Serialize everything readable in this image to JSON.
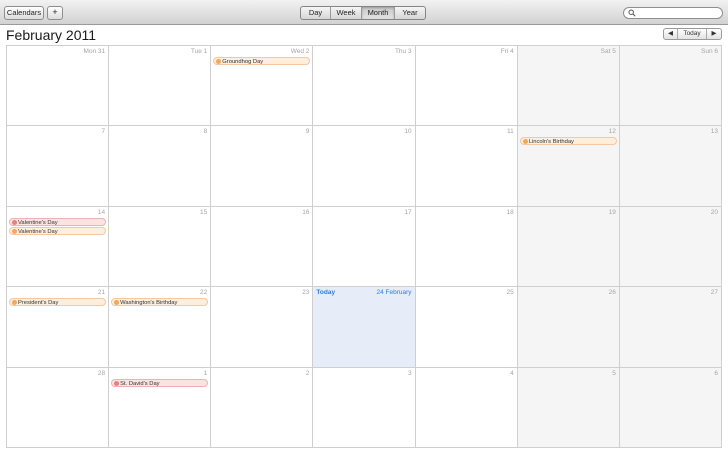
{
  "toolbar": {
    "calendars_label": "Calendars",
    "add_label": "+",
    "views": [
      {
        "label": "Day",
        "active": false
      },
      {
        "label": "Week",
        "active": false
      },
      {
        "label": "Month",
        "active": true
      },
      {
        "label": "Year",
        "active": false
      }
    ],
    "search_placeholder": ""
  },
  "header": {
    "title": "February 2011",
    "prev_label": "◀",
    "today_label": "Today",
    "next_label": "▶"
  },
  "colors": {
    "today_blue": "#2f7ae5",
    "event_orange": "#f4a65b",
    "event_red": "#e88080"
  },
  "weeks": [
    [
      {
        "label": "Mon 31"
      },
      {
        "label": "Tue 1"
      },
      {
        "label": "Wed 2",
        "events": [
          {
            "title": "Groundhog Day",
            "color": "orange"
          }
        ]
      },
      {
        "label": "Thu 3"
      },
      {
        "label": "Fri 4"
      },
      {
        "label": "Sat 5",
        "weekend": true
      },
      {
        "label": "Sun 6",
        "weekend": true
      }
    ],
    [
      {
        "label": "7"
      },
      {
        "label": "8"
      },
      {
        "label": "9"
      },
      {
        "label": "10"
      },
      {
        "label": "11"
      },
      {
        "label": "12",
        "weekend": true,
        "events": [
          {
            "title": "Lincoln's Birthday",
            "color": "orange"
          }
        ]
      },
      {
        "label": "13",
        "weekend": true
      }
    ],
    [
      {
        "label": "14",
        "events": [
          {
            "title": "Valentine's Day",
            "color": "red"
          },
          {
            "title": "Valentine's Day",
            "color": "orange"
          }
        ]
      },
      {
        "label": "15"
      },
      {
        "label": "16"
      },
      {
        "label": "17"
      },
      {
        "label": "18"
      },
      {
        "label": "19",
        "weekend": true
      },
      {
        "label": "20",
        "weekend": true
      }
    ],
    [
      {
        "label": "21",
        "events": [
          {
            "title": "President's Day",
            "color": "orange"
          }
        ]
      },
      {
        "label": "22",
        "events": [
          {
            "title": "Washington's Birthday",
            "color": "orange"
          }
        ]
      },
      {
        "label": "23"
      },
      {
        "label": "24 February",
        "today": true,
        "today_text": "Today"
      },
      {
        "label": "25"
      },
      {
        "label": "26",
        "weekend": true
      },
      {
        "label": "27",
        "weekend": true
      }
    ],
    [
      {
        "label": "28"
      },
      {
        "label": "1",
        "events": [
          {
            "title": "St. David's Day",
            "color": "red"
          }
        ]
      },
      {
        "label": "2"
      },
      {
        "label": "3"
      },
      {
        "label": "4"
      },
      {
        "label": "5",
        "weekend": true
      },
      {
        "label": "6",
        "weekend": true
      }
    ]
  ]
}
